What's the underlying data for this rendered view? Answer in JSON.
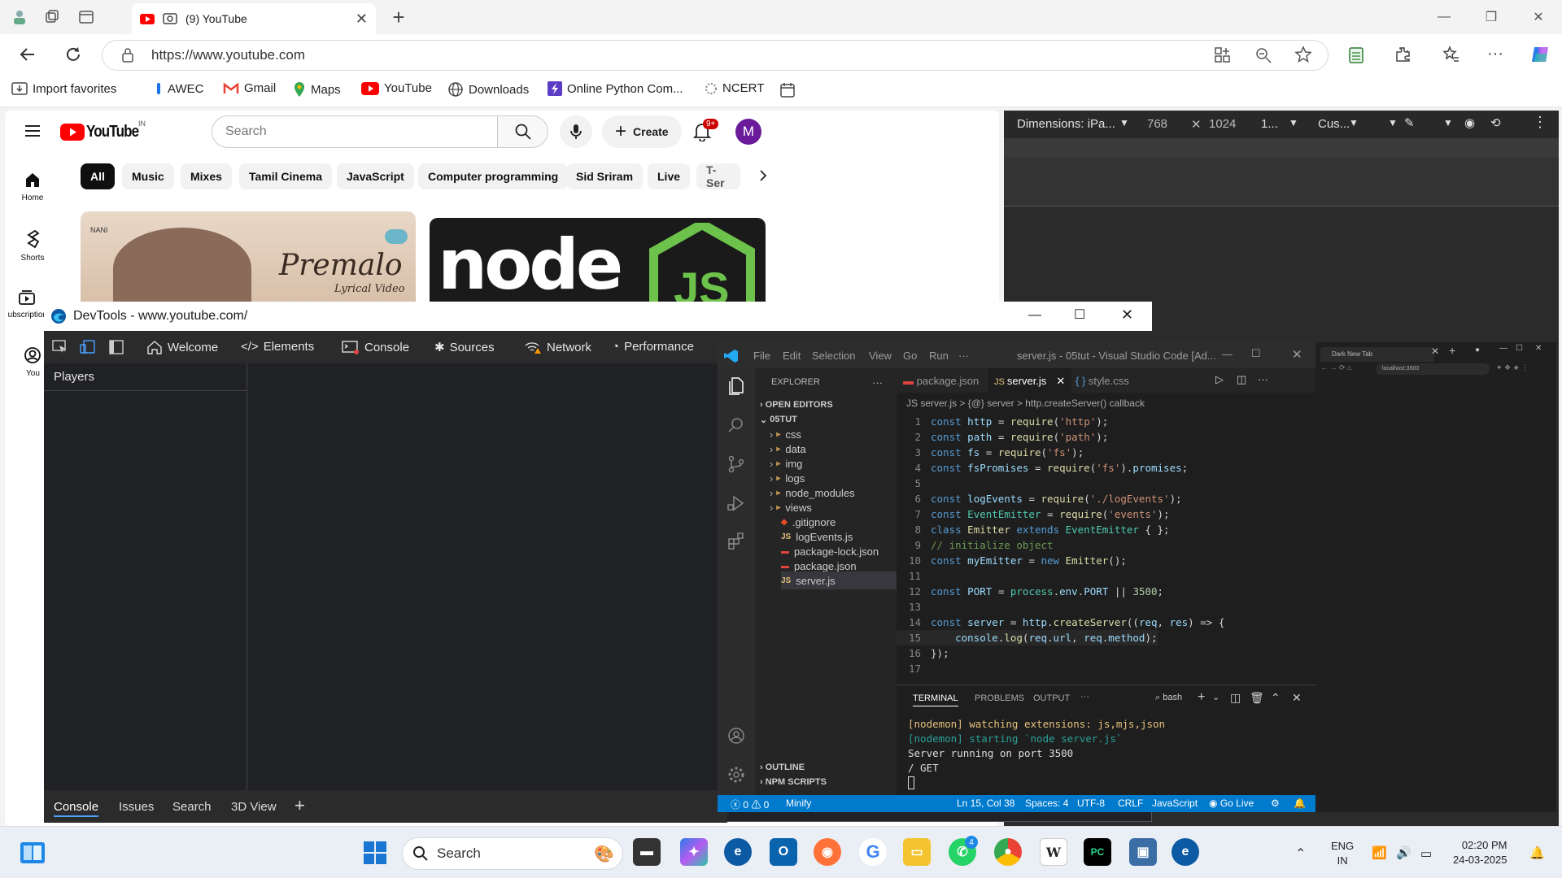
{
  "browser": {
    "tab_title": "(9) YouTube",
    "url": "https://www.youtube.com",
    "favorites": [
      "Import favorites",
      "AWEC",
      "Gmail",
      "Maps",
      "YouTube",
      "Downloads",
      "Online Python Com...",
      "NCERT"
    ]
  },
  "youtube": {
    "logo_text": "YouTube",
    "region": "IN",
    "search_placeholder": "Search",
    "create_label": "Create",
    "notif_count": "9+",
    "avatar_letter": "M",
    "chips": [
      "All",
      "Music",
      "Mixes",
      "Tamil Cinema",
      "JavaScript",
      "Computer programming",
      "Sid Sriram",
      "Live",
      "T-Ser"
    ],
    "sidebar": [
      "Home",
      "Shorts",
      "Subscriptions",
      "You"
    ],
    "thumb1_title": "Premalo",
    "thumb1_sub": "Lyrical Video",
    "thumb1_brand": "NANI",
    "thumb2_text": "node",
    "thumb2_js": "JS"
  },
  "right_devtools": {
    "dimensions_label": "Dimensions: iPa...",
    "width": "768",
    "height": "1024",
    "zoom": "1...",
    "throttle": "Cus..."
  },
  "devtools": {
    "window_title": "DevTools - www.youtube.com/",
    "tabs": [
      "Welcome",
      "Elements",
      "Console",
      "Sources",
      "Network",
      "Performance"
    ],
    "panel_title": "Players",
    "bottom_tabs": [
      "Console",
      "Issues",
      "Search",
      "3D View"
    ]
  },
  "vscode": {
    "menu": [
      "File",
      "Edit",
      "Selection",
      "View",
      "Go",
      "Run",
      "···"
    ],
    "title": "server.js - 05tut - Visual Studio Code [Ad...",
    "explorer_label": "EXPLORER",
    "open_editors": "OPEN EDITORS",
    "project": "05TUT",
    "tree": [
      {
        "name": "css",
        "type": "folder"
      },
      {
        "name": "data",
        "type": "folder"
      },
      {
        "name": "img",
        "type": "folder"
      },
      {
        "name": "logs",
        "type": "folder"
      },
      {
        "name": "node_modules",
        "type": "folder"
      },
      {
        "name": "views",
        "type": "folder"
      },
      {
        "name": ".gitignore",
        "type": "file"
      },
      {
        "name": "logEvents.js",
        "type": "js"
      },
      {
        "name": "package-lock.json",
        "type": "json"
      },
      {
        "name": "package.json",
        "type": "json"
      },
      {
        "name": "server.js",
        "type": "js"
      }
    ],
    "outline": "OUTLINE",
    "npm_scripts": "NPM SCRIPTS",
    "editor_tabs": [
      "package.json",
      "server.js",
      "style.css"
    ],
    "breadcrumb": "JS server.js > {@} server > http.createServer() callback",
    "code": [
      "const http = require('http');",
      "const path = require('path');",
      "const fs = require('fs');",
      "const fsPromises = require('fs').promises;",
      "",
      "const logEvents = require('./logEvents');",
      "const EventEmitter = require('events');",
      "class Emitter extends EventEmitter { };",
      "// initialize object",
      "const myEmitter = new Emitter();",
      "",
      "const PORT = process.env.PORT || 3500;",
      "",
      "const server = http.createServer((req, res) => {",
      "    console.log(req.url, req.method);",
      "});",
      ""
    ],
    "terminal_tabs": [
      "TERMINAL",
      "PROBLEMS",
      "OUTPUT",
      "···"
    ],
    "shell": "bash",
    "terminal_lines": [
      "[nodemon] watching extensions: js,mjs,json",
      "[nodemon] starting `node server.js`",
      "Server running on port 3500",
      "/ GET"
    ],
    "status_left": [
      "ⓧ 0 ⚠ 0",
      "Minify"
    ],
    "status_right": [
      "Ln 15, Col 38",
      "Spaces: 4",
      "UTF-8",
      "CRLF",
      "JavaScript",
      "Go Live"
    ]
  },
  "mini_browser": {
    "tab": "Dark New Tab",
    "url": "localhost:3500"
  },
  "taskbar": {
    "search": "Search",
    "lang1": "ENG",
    "lang2": "IN",
    "time": "02:20 PM",
    "date": "24-03-2025",
    "whatsapp_badge": "4"
  }
}
